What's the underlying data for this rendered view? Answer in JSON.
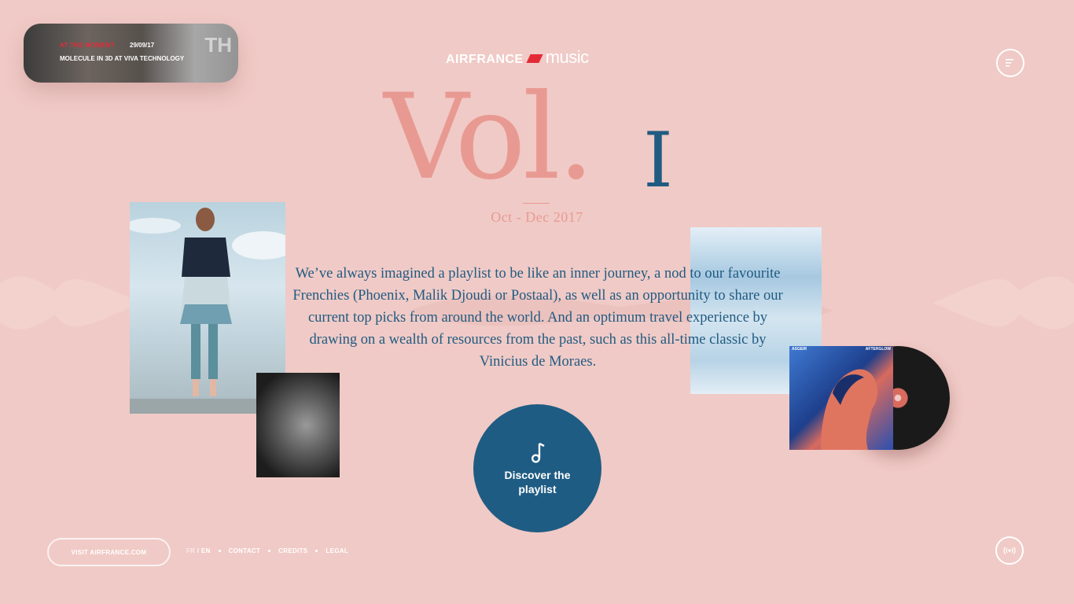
{
  "news": {
    "tag": "AT THE MOMENT",
    "date": "29/09/17",
    "headline": "MOLECULE IN 3D AT VIVA TECHNOLOGY",
    "bg_text": "TH"
  },
  "logo": {
    "brand": "AIRFRANCE",
    "music": "music"
  },
  "hero": {
    "vol": "Vol.",
    "number": "I",
    "period": "Oct - Dec 2017"
  },
  "blurb": "We’ve always imagined a playlist to be like an inner journey, a nod to our favourite Frenchies (Phoenix, Malik Djoudi or Postaal), as well as an opportunity to share our current top picks from around the world. And an optimum travel experience by drawing on a wealth of resources from the past, such as this all-time classic by Vinicius de Moraes.",
  "album": {
    "artist": "ASGEIR",
    "title": "AFTERGLOW"
  },
  "cta": {
    "label": "Discover the playlist",
    "icon": "music-note-icon"
  },
  "footer": {
    "visit": "VISIT AIRFRANCE.COM",
    "lang_fr": "FR",
    "lang_sep": "/",
    "lang_en": "EN",
    "contact": "CONTACT",
    "credits": "CREDITS",
    "legal": "LEGAL"
  },
  "icons": {
    "menu": "menu-icon",
    "sound": "sound-wave-icon"
  },
  "colors": {
    "background": "#f0cac6",
    "accent_blue": "#205b82",
    "accent_pink": "#e89a92",
    "brand_red": "#e32b38"
  }
}
